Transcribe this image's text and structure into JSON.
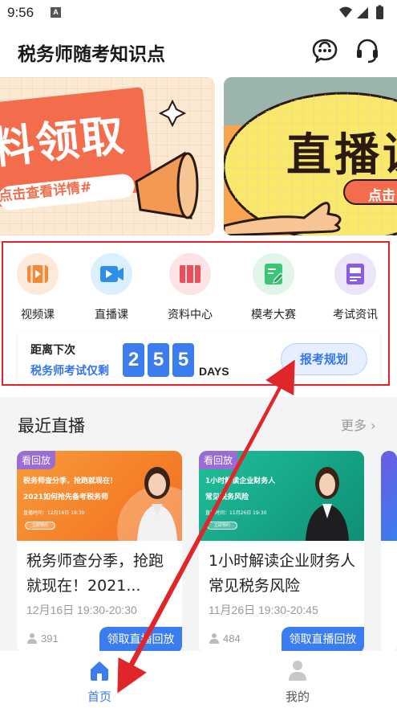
{
  "status_bar": {
    "time": "9:56",
    "indicator": "A"
  },
  "header": {
    "title": "税务师随考知识点",
    "icons": [
      "chat-icon",
      "headset-icon"
    ]
  },
  "banners": [
    {
      "headline": "料领取",
      "sub": "点击查看详情#"
    },
    {
      "headline": "直播课",
      "sub": "点击"
    }
  ],
  "entries": [
    {
      "label": "视频课",
      "icon": "video-icon",
      "bg": "#fde9d9",
      "fg": "#f08a3b"
    },
    {
      "label": "直播课",
      "icon": "live-icon",
      "bg": "#dcefff",
      "fg": "#2e8fe8"
    },
    {
      "label": "资料中心",
      "icon": "books-icon",
      "bg": "#fde3e3",
      "fg": "#e8505b"
    },
    {
      "label": "模考大赛",
      "icon": "exam-icon",
      "bg": "#dff6e8",
      "fg": "#3cc477"
    },
    {
      "label": "考试资讯",
      "icon": "news-icon",
      "bg": "#ece4fb",
      "fg": "#8a5ce0"
    }
  ],
  "countdown": {
    "label1": "距离下次",
    "label2": "税务师考试仅剩",
    "digits": [
      "2",
      "5",
      "5"
    ],
    "unit": "DAYS",
    "button": "报考规划"
  },
  "recent_live": {
    "title": "最近直播",
    "more": "更多",
    "cards": [
      {
        "badge": "看回放",
        "thumb_line1": "税务师查分季，抢跑就现在！",
        "thumb_line2": "2021如何抢先备考税务师",
        "thumb_line3": "直播时间：12月16日 19:30",
        "thumb_btn": "立即预约",
        "title": "税务师查分季，抢跑就现在！2021...",
        "time": "12月16日 19:30-20:30",
        "viewers": "391",
        "button": "领取直播回放"
      },
      {
        "badge": "看回放",
        "thumb_line1": "1小时解读企业财务人",
        "thumb_line2": "常见税务风险",
        "thumb_line3": "直播时间：11月26日 19:30",
        "thumb_btn": "立即预约",
        "title": "1小时解读企业财务人常见税务风险",
        "time": "11月26日 19:30-20:45",
        "viewers": "484",
        "button": "领取直播回放"
      }
    ]
  },
  "bottom_nav": [
    {
      "label": "首页",
      "active": true
    },
    {
      "label": "我的",
      "active": false
    }
  ],
  "colors": {
    "accent": "#3b7cf0",
    "annotation": "#e0262b"
  }
}
